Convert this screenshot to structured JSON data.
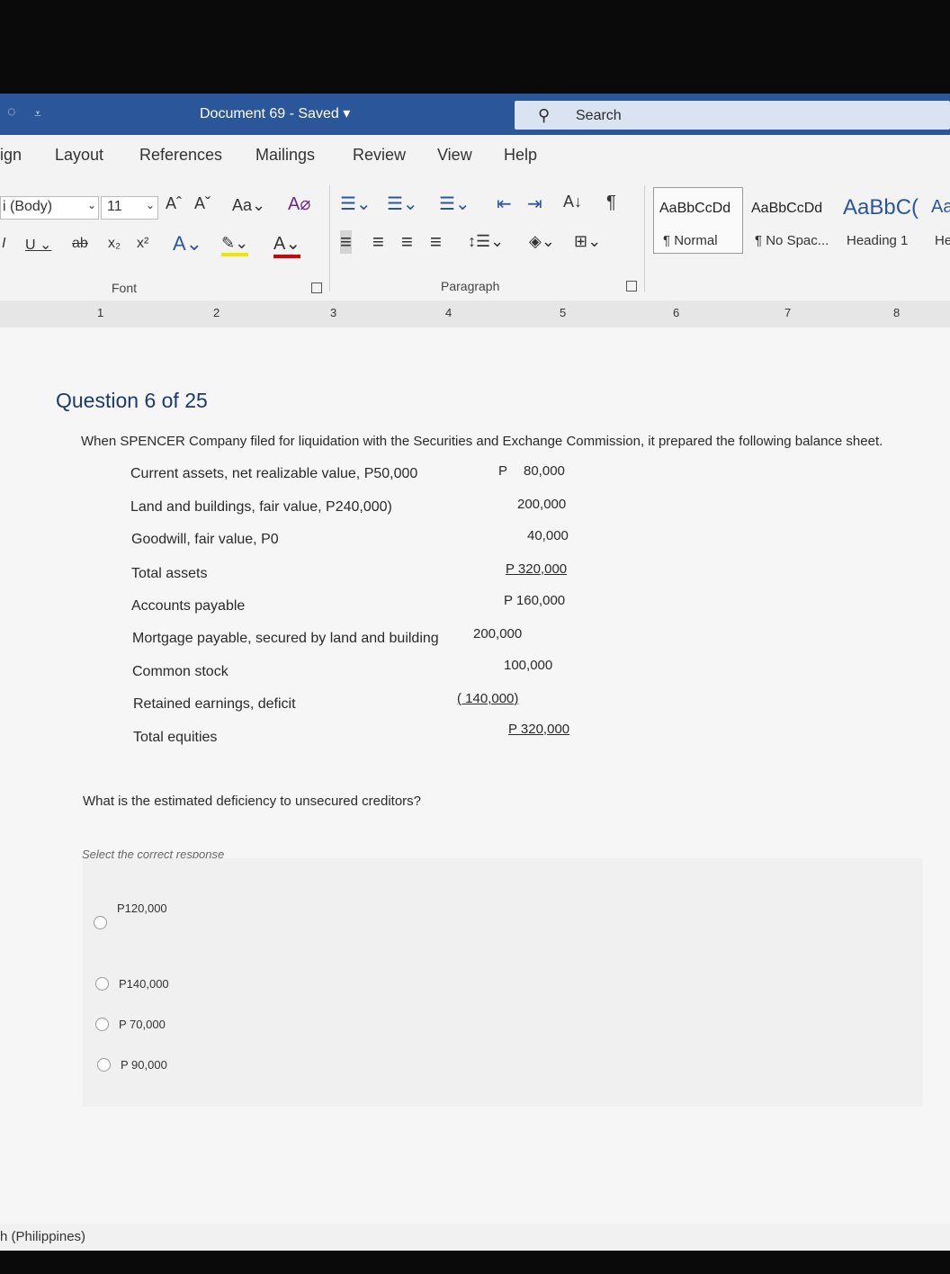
{
  "titlebar": {
    "document_title": "Document 69  -  Saved  ▾",
    "search_placeholder": "Search"
  },
  "ribbon": {
    "tabs": [
      "ign",
      "Layout",
      "References",
      "Mailings",
      "Review",
      "View",
      "Help"
    ],
    "font": {
      "name": "i (Body)",
      "size": "11",
      "group_label": "Font"
    },
    "paragraph": {
      "group_label": "Paragraph"
    },
    "styles": [
      {
        "sample": "AaBbCcDd",
        "name": "¶ Normal"
      },
      {
        "sample": "AaBbCcDd",
        "name": "¶ No Spac..."
      },
      {
        "sample": "AaBbC(",
        "name": "Heading 1"
      },
      {
        "sample": "Aa",
        "name": "He"
      }
    ]
  },
  "ruler": {
    "numbers": [
      "1",
      "2",
      "3",
      "4",
      "5",
      "6",
      "7",
      "8"
    ]
  },
  "document": {
    "question_title": "Question 6 of 25",
    "intro": "When SPENCER Company filed for liquidation with the Securities and Exchange Commission, it prepared the following balance sheet.",
    "rows": [
      {
        "label": "Current assets, net realizable value, P50,000",
        "prefix": "P",
        "amount": "80,000"
      },
      {
        "label": "Land and buildings, fair value, P240,000)",
        "prefix": "",
        "amount": "200,000"
      },
      {
        "label": "Goodwill, fair value, P0",
        "prefix": "",
        "amount": "40,000"
      },
      {
        "label": "Total assets",
        "prefix": "",
        "amount": "P 320,000"
      },
      {
        "label": "Accounts payable",
        "prefix": "",
        "amount": "P 160,000"
      },
      {
        "label": "Mortgage payable, secured by land and building",
        "prefix": "",
        "amount": "200,000"
      },
      {
        "label": "Common stock",
        "prefix": "",
        "amount": "100,000"
      },
      {
        "label": "Retained earnings, deficit",
        "prefix": "",
        "amount": "( 140,000)"
      },
      {
        "label": "Total equities",
        "prefix": "",
        "amount": "P 320,000"
      }
    ],
    "question": "What is the estimated deficiency to unsecured creditors?",
    "select_prompt": "Select the correct response",
    "options": [
      "P120,000",
      "P140,000",
      "P 70,000",
      "P 90,000"
    ]
  },
  "statusbar": {
    "language": "h (Philippines)"
  }
}
